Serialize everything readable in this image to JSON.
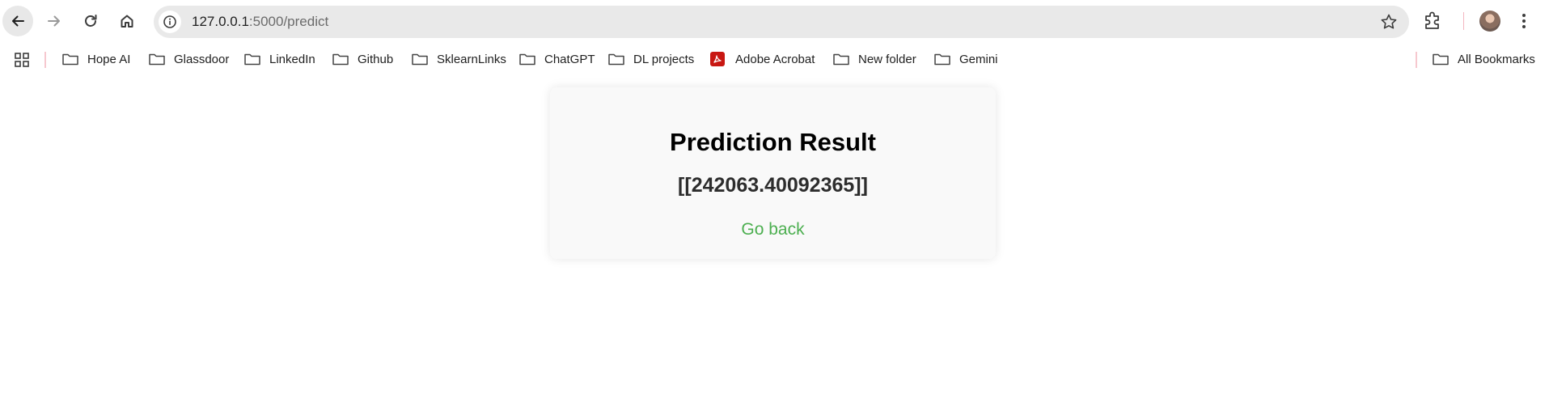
{
  "browser": {
    "address_bar": {
      "host": "127.0.0.1",
      "path": ":5000/predict"
    },
    "icons": {
      "back": "arrow-left-icon",
      "forward": "arrow-right-icon",
      "reload": "reload-icon",
      "home": "home-icon",
      "site_info": "info-icon",
      "bookmark_star": "star-icon",
      "extensions": "puzzle-icon",
      "menu": "kebab-menu-icon"
    },
    "colors": {
      "toolbar_bg": "#ffffff",
      "omnibox_bg": "#e9e9e9",
      "separator": "#f6c8cf"
    }
  },
  "bookmarks_bar": {
    "items": [
      {
        "label": "Hope AI",
        "icon": "folder-icon"
      },
      {
        "label": "Glassdoor",
        "icon": "folder-icon"
      },
      {
        "label": "LinkedIn",
        "icon": "folder-icon"
      },
      {
        "label": "Github",
        "icon": "folder-icon"
      },
      {
        "label": "SklearnLinks",
        "icon": "folder-icon"
      },
      {
        "label": "ChatGPT",
        "icon": "folder-icon"
      },
      {
        "label": "DL projects",
        "icon": "folder-icon"
      },
      {
        "label": "Adobe Acrobat",
        "icon": "pdf-icon"
      },
      {
        "label": "New folder",
        "icon": "folder-icon"
      },
      {
        "label": "Gemini",
        "icon": "folder-icon"
      }
    ],
    "all_bookmarks": "All Bookmarks"
  },
  "page": {
    "title": "Prediction Result",
    "result": "[[242063.40092365]]",
    "back_link": "Go back",
    "colors": {
      "card_bg": "#f9f9f9",
      "link": "#4caf50",
      "result_text": "#2d2d2d"
    }
  }
}
